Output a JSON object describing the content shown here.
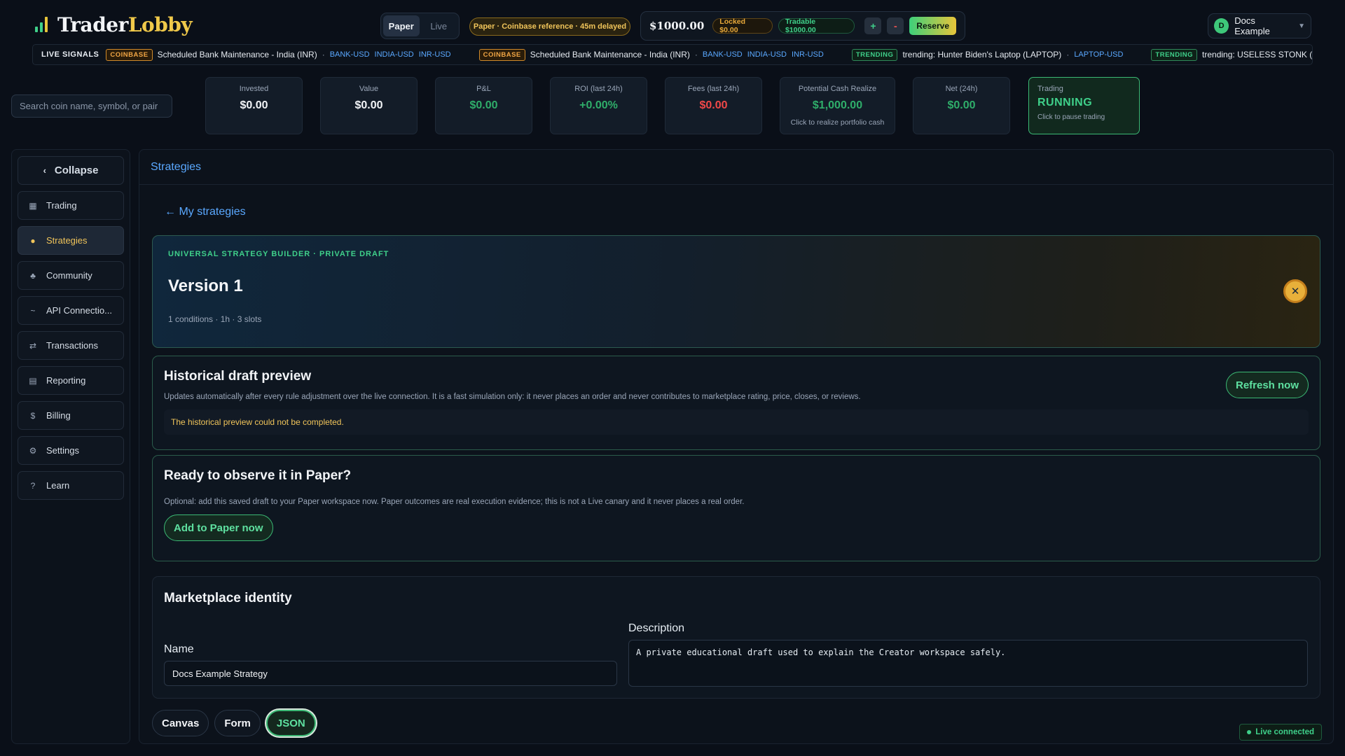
{
  "brand": {
    "part1": "Trader",
    "part2": "Lobby"
  },
  "mode": {
    "paper": "Paper",
    "live": "Live"
  },
  "reference_badge": "Paper · Coinbase reference · 45m delayed",
  "balance": {
    "amount": "$1000.00",
    "locked": "Locked $0.00",
    "tradable": "Tradable $1000.00",
    "plus": "+",
    "minus": "-",
    "reserve": "Reserve"
  },
  "user": {
    "initial": "D",
    "name": "Docs Example"
  },
  "ticker": {
    "label": "LIVE SIGNALS",
    "items": [
      {
        "tag": "COINBASE",
        "text": "Scheduled Bank Maintenance - India (INR)",
        "symbols": [
          "BANK-USD",
          "INDIA-USD",
          "INR-USD"
        ]
      },
      {
        "tag": "COINBASE",
        "text": "Scheduled Bank Maintenance - India (INR)",
        "symbols": [
          "BANK-USD",
          "INDIA-USD",
          "INR-USD"
        ]
      },
      {
        "tag": "TRENDING",
        "text": "trending: Hunter Biden's Laptop (LAPTOP)",
        "symbols": [
          "LAPTOP-USD"
        ]
      },
      {
        "tag": "TRENDING",
        "text": "trending: USELESS STONK (STONK",
        "symbols": []
      }
    ]
  },
  "search": {
    "placeholder": "Search coin name, symbol, or pair"
  },
  "stats": [
    {
      "label": "Invested",
      "value": "$0.00",
      "color": "#f2f4f7"
    },
    {
      "label": "Value",
      "value": "$0.00",
      "color": "#f2f4f7"
    },
    {
      "label": "P&L",
      "value": "$0.00",
      "color": "#2fae6a"
    },
    {
      "label": "ROI (last 24h)",
      "value": "+0.00%",
      "color": "#2fae6a"
    },
    {
      "label": "Fees (last 24h)",
      "value": "$0.00",
      "color": "#f04848"
    },
    {
      "label": "Potential Cash Realize",
      "value": "$1,000.00",
      "sub": "Click to realize portfolio cash",
      "color": "#2fae6a"
    },
    {
      "label": "Net (24h)",
      "value": "$0.00",
      "color": "#2fae6a"
    }
  ],
  "trading": {
    "label": "Trading",
    "status": "RUNNING",
    "hint": "Click to pause trading"
  },
  "sidebar": {
    "collapse": "Collapse",
    "items": [
      {
        "label": "Trading",
        "icon": "grid-icon"
      },
      {
        "label": "Strategies",
        "icon": "bulb-icon"
      },
      {
        "label": "Community",
        "icon": "community-icon"
      },
      {
        "label": "API Connectio...",
        "icon": "wave-icon"
      },
      {
        "label": "Transactions",
        "icon": "swap-icon"
      },
      {
        "label": "Reporting",
        "icon": "report-icon"
      },
      {
        "label": "Billing",
        "icon": "dollar-icon"
      },
      {
        "label": "Settings",
        "icon": "gear-icon"
      },
      {
        "label": "Learn",
        "icon": "question-icon"
      }
    ]
  },
  "main": {
    "header": "Strategies",
    "back": "← My strategies",
    "hero": {
      "eyebrow": "UNIVERSAL STRATEGY BUILDER · PRIVATE DRAFT",
      "title": "Version 1",
      "meta": "1 conditions · 1h · 3 slots"
    },
    "preview": {
      "title": "Historical draft preview",
      "desc": "Updates automatically after every rule adjustment over the live connection. It is a fast simulation only: it never places an order and never contributes to marketplace rating, price, closes, or reviews.",
      "warning": "The historical preview could not be completed.",
      "refresh": "Refresh now"
    },
    "observe": {
      "title": "Ready to observe it in Paper?",
      "desc": "Optional: add this saved draft to your Paper workspace now. Paper outcomes are real execution evidence; this is not a Live canary and it never places a real order.",
      "button": "Add to Paper now"
    },
    "marketplace": {
      "title": "Marketplace identity",
      "name_label": "Name",
      "name_value": "Docs Example Strategy",
      "desc_label": "Description",
      "desc_value": "A private educational draft used to explain the Creator workspace safely."
    },
    "tabs": [
      "Canvas",
      "Form",
      "JSON"
    ],
    "live_status": "Live connected"
  }
}
